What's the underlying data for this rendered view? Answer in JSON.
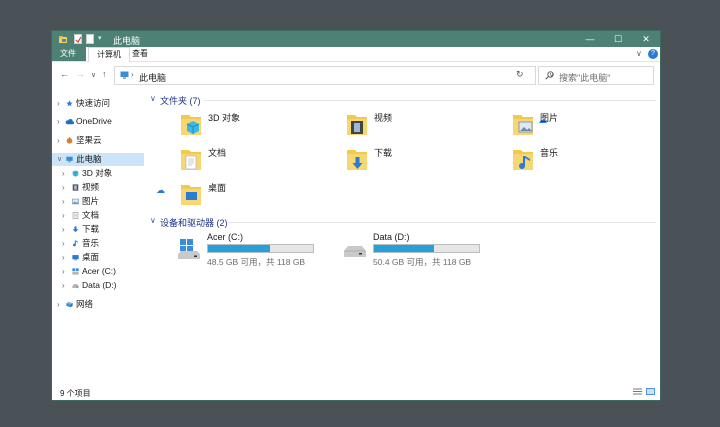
{
  "window": {
    "title": "此电脑",
    "controls": {
      "minimize": "—",
      "maximize": "☐",
      "close": "✕"
    }
  },
  "ribbon": {
    "tabs": [
      "文件",
      "计算机",
      "查看"
    ],
    "help": "?"
  },
  "address": {
    "back": "←",
    "forward": "→",
    "recent": "∨",
    "up": "↑",
    "path": "此电脑",
    "refresh": "↻",
    "search_placeholder": "搜索\"此电脑\""
  },
  "sidebar": {
    "items": [
      {
        "label": "快速访问",
        "icon": "star-icon",
        "color": "#2a7bd6"
      },
      {
        "label": "OneDrive",
        "icon": "cloud-icon",
        "color": "#1f6fc5"
      },
      {
        "label": "坚果云",
        "icon": "nut-icon",
        "color": "#d9812b"
      },
      {
        "label": "此电脑",
        "icon": "computer-icon",
        "color": "#3b8ddc"
      },
      {
        "label": "3D 对象",
        "icon": "cube-icon",
        "color": "#3bb7e8"
      },
      {
        "label": "视频",
        "icon": "film-icon",
        "color": "#555555"
      },
      {
        "label": "图片",
        "icon": "picture-icon",
        "color": "#6a8bb0"
      },
      {
        "label": "文档",
        "icon": "document-icon",
        "color": "#8a8a8a"
      },
      {
        "label": "下载",
        "icon": "download-icon",
        "color": "#2a7bd6"
      },
      {
        "label": "音乐",
        "icon": "music-icon",
        "color": "#2a7bd6"
      },
      {
        "label": "桌面",
        "icon": "desktop-icon",
        "color": "#2a7bd6"
      },
      {
        "label": "Acer (C:)",
        "icon": "windows-drive-icon",
        "color": "#3b8ddc"
      },
      {
        "label": "Data (D:)",
        "icon": "drive-icon",
        "color": "#777777"
      },
      {
        "label": "网络",
        "icon": "network-icon",
        "color": "#3b8ddc"
      }
    ]
  },
  "main": {
    "folders_group": "文件夹 (7)",
    "folders": [
      {
        "label": "3D 对象",
        "icon": "cube-folder-icon"
      },
      {
        "label": "视频",
        "icon": "video-folder-icon"
      },
      {
        "label": "图片",
        "icon": "pictures-folder-icon"
      },
      {
        "label": "文档",
        "icon": "documents-folder-icon"
      },
      {
        "label": "下载",
        "icon": "downloads-folder-icon"
      },
      {
        "label": "音乐",
        "icon": "music-folder-icon"
      },
      {
        "label": "桌面",
        "icon": "desktop-folder-icon"
      }
    ],
    "drives_group": "设备和驱动器 (2)",
    "drives": [
      {
        "label": "Acer (C:)",
        "free_text": "48.5 GB 可用，共 118 GB",
        "used_fraction": 0.59,
        "icon": "windows-drive-icon"
      },
      {
        "label": "Data (D:)",
        "free_text": "50.4 GB 可用，共 118 GB",
        "used_fraction": 0.57,
        "icon": "drive-icon"
      }
    ]
  },
  "status": {
    "count": "9 个项目"
  },
  "colors": {
    "titlebar": "#4e8175",
    "accent": "#26a0da",
    "group_header": "#1e3287",
    "selection": "#cce4f7"
  }
}
